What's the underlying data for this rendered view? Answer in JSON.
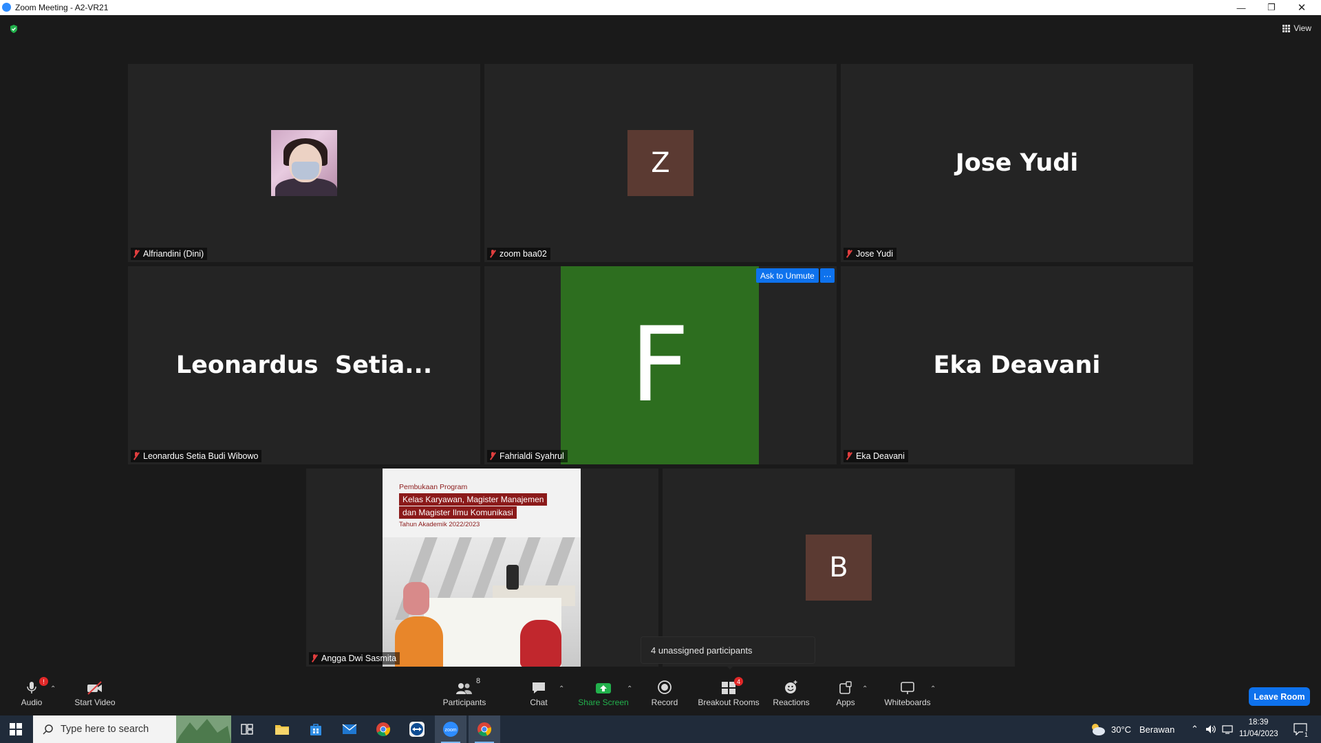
{
  "window": {
    "title": "Zoom Meeting - A2-VR21"
  },
  "view_button": {
    "label": "View"
  },
  "tiles": [
    {
      "display_name": "Alfriandini (Dini)",
      "avatar_type": "photo"
    },
    {
      "display_name": "zoom baa02",
      "avatar_letter": "Z",
      "avatar_color": "#5b3a32"
    },
    {
      "display_name": "Jose Yudi",
      "center_name": "Jose Yudi"
    },
    {
      "display_name": "Leonardus Setia Budi Wibowo",
      "center_name": "Leonardus  Setia..."
    },
    {
      "display_name": "Fahrialdi Syahrul",
      "avatar_letter": "F",
      "avatar_color": "#2d6e1f"
    },
    {
      "display_name": "Eka Deavani",
      "center_name": "Eka Deavani"
    },
    {
      "display_name": "Angga Dwi Sasmita",
      "avatar_type": "screen"
    },
    {
      "avatar_letter": "B",
      "avatar_color": "#5b3a32"
    }
  ],
  "hover_controls": {
    "ask_unmute": "Ask to Unmute",
    "more": "···"
  },
  "shared_content": {
    "pretitle": "Pembukaan Program",
    "headline_1": "Kelas Karyawan, Magister Manajemen",
    "headline_2": "dan Magister Ilmu Komunikasi",
    "academic_year": "Tahun Akademik 2022/2023"
  },
  "tooltip": {
    "text": "4 unassigned participants"
  },
  "toolbar": {
    "audio": "Audio",
    "audio_alert": "!",
    "start_video": "Start Video",
    "participants": "Participants",
    "participants_count": "8",
    "chat": "Chat",
    "share_screen": "Share Screen",
    "record": "Record",
    "breakout_rooms": "Breakout Rooms",
    "breakout_count": "4",
    "reactions": "Reactions",
    "apps": "Apps",
    "whiteboards": "Whiteboards",
    "leave": "Leave Room"
  },
  "taskbar": {
    "search_placeholder": "Type here to search",
    "weather_temp": "30°C",
    "weather_text": "Berawan",
    "time": "18:39",
    "date": "11/04/2023",
    "notification_count": "1"
  },
  "colors": {
    "accent_blue": "#0e72ed",
    "mute_red": "#e03e3e",
    "share_green": "#22b14c"
  }
}
